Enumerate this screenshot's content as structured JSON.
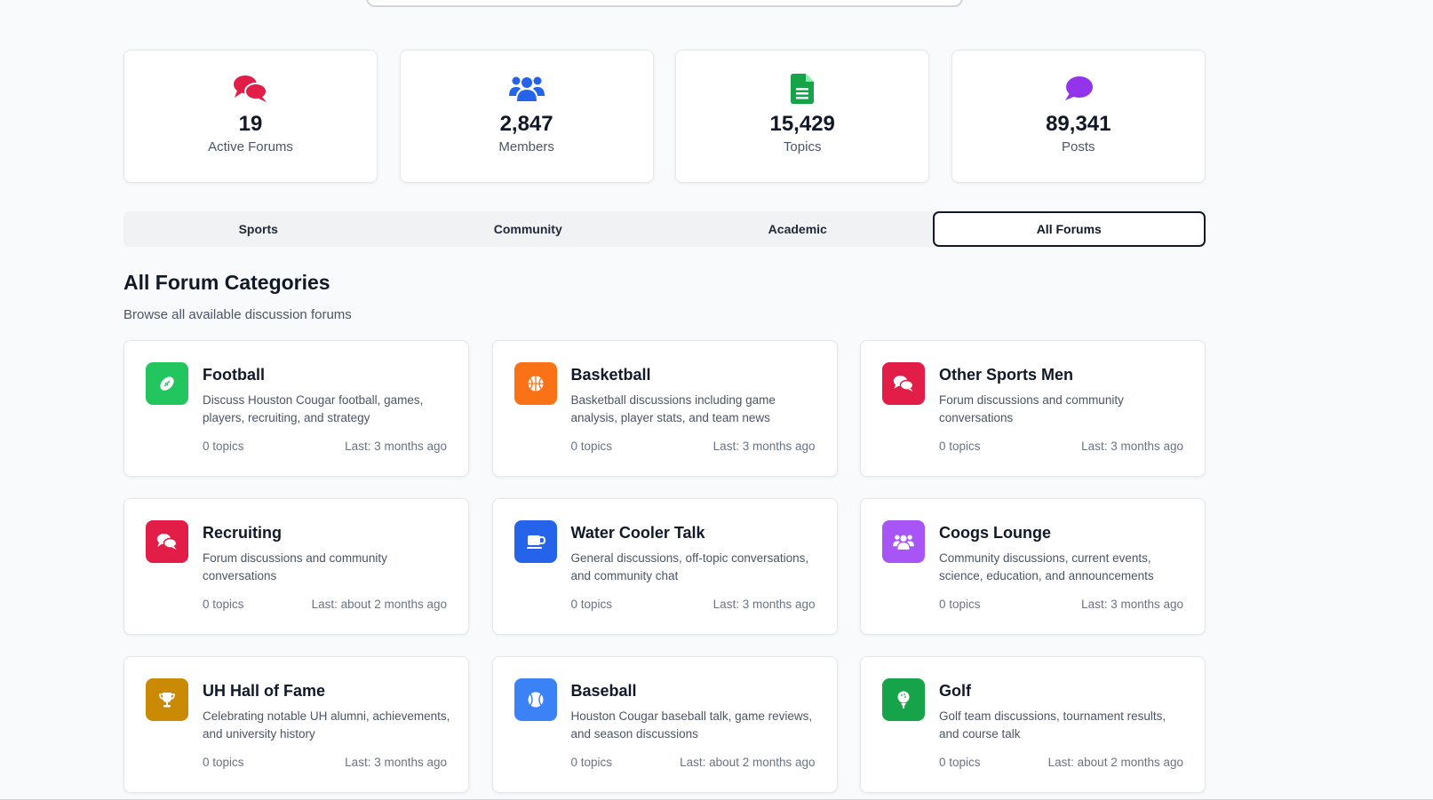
{
  "stats": [
    {
      "value": "19",
      "label": "Active Forums",
      "icon": "comments-icon",
      "color": "#e11d48"
    },
    {
      "value": "2,847",
      "label": "Members",
      "icon": "users-icon",
      "color": "#2563eb"
    },
    {
      "value": "15,429",
      "label": "Topics",
      "icon": "file-icon",
      "color": "#16a34a"
    },
    {
      "value": "89,341",
      "label": "Posts",
      "icon": "comment-icon",
      "color": "#9333ea"
    }
  ],
  "tabs": [
    {
      "label": "Sports",
      "active": false
    },
    {
      "label": "Community",
      "active": false
    },
    {
      "label": "Academic",
      "active": false
    },
    {
      "label": "All Forums",
      "active": true
    }
  ],
  "section": {
    "title": "All Forum Categories",
    "subtitle": "Browse all available discussion forums"
  },
  "forums": [
    {
      "title": "Football",
      "desc": "Discuss Houston Cougar football, games, players, recruiting, and strategy",
      "topics": "0 topics",
      "last": "Last: 3 months ago",
      "icon": "football-icon",
      "color": "#22c55e"
    },
    {
      "title": "Basketball",
      "desc": "Basketball discussions including game analysis, player stats, and team news",
      "topics": "0 topics",
      "last": "Last: 3 months ago",
      "icon": "basketball-icon",
      "color": "#f97316"
    },
    {
      "title": "Other Sports Men",
      "desc": "Forum discussions and community conversations",
      "topics": "0 topics",
      "last": "Last: 3 months ago",
      "icon": "comments-icon",
      "color": "#e11d48"
    },
    {
      "title": "Recruiting",
      "desc": "Forum discussions and community conversations",
      "topics": "0 topics",
      "last": "Last: about 2 months ago",
      "icon": "comments-icon",
      "color": "#e11d48"
    },
    {
      "title": "Water Cooler Talk",
      "desc": "General discussions, off-topic conversations, and community chat",
      "topics": "0 topics",
      "last": "Last: 3 months ago",
      "icon": "coffee-icon",
      "color": "#2563eb"
    },
    {
      "title": "Coogs Lounge",
      "desc": "Community discussions, current events, science, education, and announcements",
      "topics": "0 topics",
      "last": "Last: 3 months ago",
      "icon": "users-icon",
      "color": "#a855f7"
    },
    {
      "title": "UH Hall of Fame",
      "desc": "Celebrating notable UH alumni, achievements, and university history",
      "topics": "0 topics",
      "last": "Last: 3 months ago",
      "icon": "trophy-icon",
      "color": "#ca8a04"
    },
    {
      "title": "Baseball",
      "desc": "Houston Cougar baseball talk, game reviews, and season discussions",
      "topics": "0 topics",
      "last": "Last: about 2 months ago",
      "icon": "baseball-icon",
      "color": "#3b82f6"
    },
    {
      "title": "Golf",
      "desc": "Golf team discussions, tournament results, and course talk",
      "topics": "0 topics",
      "last": "Last: about 2 months ago",
      "icon": "golf-icon",
      "color": "#16a34a"
    }
  ]
}
